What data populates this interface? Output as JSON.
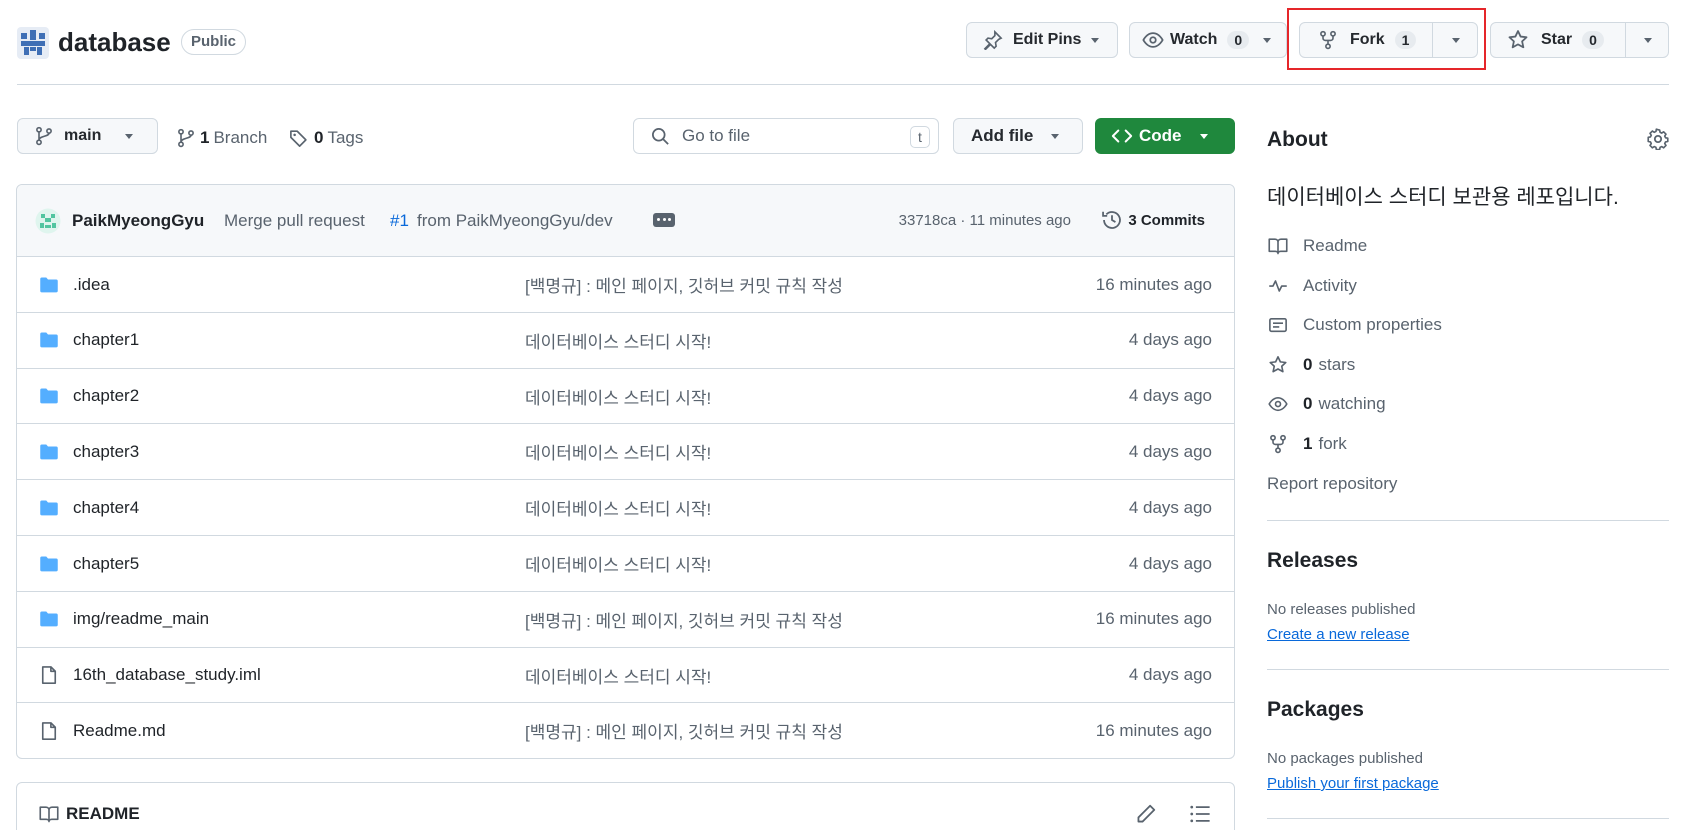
{
  "repo": {
    "name": "database",
    "visibility": "Public"
  },
  "header": {
    "edit_pins": "Edit Pins",
    "watch": {
      "label": "Watch",
      "count": "0"
    },
    "fork": {
      "label": "Fork",
      "count": "1"
    },
    "star": {
      "label": "Star",
      "count": "0"
    }
  },
  "toolbar": {
    "branch": "main",
    "branch_count": "1",
    "branch_label": "Branch",
    "tag_count": "0",
    "tag_label": "Tags",
    "search_placeholder": "Go to file",
    "search_shortcut": "t",
    "add_file": "Add file",
    "code": "Code"
  },
  "commit": {
    "author": "PaikMyeongGyu",
    "message_prefix": "Merge pull request",
    "pr": "#1",
    "message_suffix": "from PaikMyeongGyu/dev",
    "meta": "33718ca · 11 minutes ago",
    "commits": "3 Commits"
  },
  "files": [
    {
      "type": "folder",
      "name": ".idea",
      "message": "[백명규] : 메인 페이지, 깃허브 커밋 규칙 작성",
      "age": "16 minutes ago"
    },
    {
      "type": "folder",
      "name": "chapter1",
      "message": "데이터베이스 스터디 시작!",
      "age": "4 days ago"
    },
    {
      "type": "folder",
      "name": "chapter2",
      "message": "데이터베이스 스터디 시작!",
      "age": "4 days ago"
    },
    {
      "type": "folder",
      "name": "chapter3",
      "message": "데이터베이스 스터디 시작!",
      "age": "4 days ago"
    },
    {
      "type": "folder",
      "name": "chapter4",
      "message": "데이터베이스 스터디 시작!",
      "age": "4 days ago"
    },
    {
      "type": "folder",
      "name": "chapter5",
      "message": "데이터베이스 스터디 시작!",
      "age": "4 days ago"
    },
    {
      "type": "folder",
      "name": "img/readme_main",
      "message": "[백명규] : 메인 페이지, 깃허브 커밋 규칙 작성",
      "age": "16 minutes ago"
    },
    {
      "type": "file",
      "name": "16th_database_study.iml",
      "message": "데이터베이스 스터디 시작!",
      "age": "4 days ago"
    },
    {
      "type": "file",
      "name": "Readme.md",
      "message": "[백명규] : 메인 페이지, 깃허브 커밋 규칙 작성",
      "age": "16 minutes ago"
    }
  ],
  "readme": {
    "label": "README"
  },
  "about": {
    "title": "About",
    "description": "데이터베이스 스터디 보관용 레포입니다.",
    "readme": "Readme",
    "activity": "Activity",
    "custom_properties": "Custom properties",
    "stars_count": "0",
    "stars_label": "stars",
    "watching_count": "0",
    "watching_label": "watching",
    "fork_count": "1",
    "fork_label": "fork",
    "report": "Report repository"
  },
  "releases": {
    "title": "Releases",
    "empty": "No releases published",
    "link": "Create a new release"
  },
  "packages": {
    "title": "Packages",
    "empty": "No packages published",
    "link": "Publish your first package"
  },
  "colors": {
    "accent_green": "#1f883d",
    "link_blue": "#0969da",
    "folder_blue": "#54aeff",
    "highlight_red": "#e5262a"
  }
}
